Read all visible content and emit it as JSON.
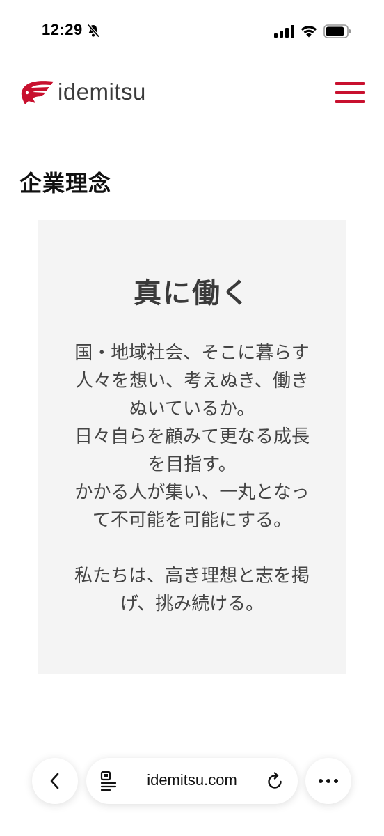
{
  "status_bar": {
    "time": "12:29"
  },
  "site_header": {
    "logo_text": "idemitsu",
    "brand_color": "#c8102e"
  },
  "section": {
    "heading": "企業理念"
  },
  "philosophy": {
    "title": "真に働く",
    "lines": [
      "国・地域社会、そこに暮らす",
      "人々を想い、考えぬき、働き",
      "ぬいているか。",
      "日々自らを顧みて更なる成長",
      "を目指す。",
      "かかる人が集い、一丸となっ",
      "て不可能を可能にする。",
      "私たちは、高き理想と志を掲",
      "げ、挑み続ける。"
    ]
  },
  "browser": {
    "url": "idemitsu.com",
    "icons": [
      "back-icon",
      "reader-icon",
      "reload-icon",
      "more-icon"
    ]
  }
}
